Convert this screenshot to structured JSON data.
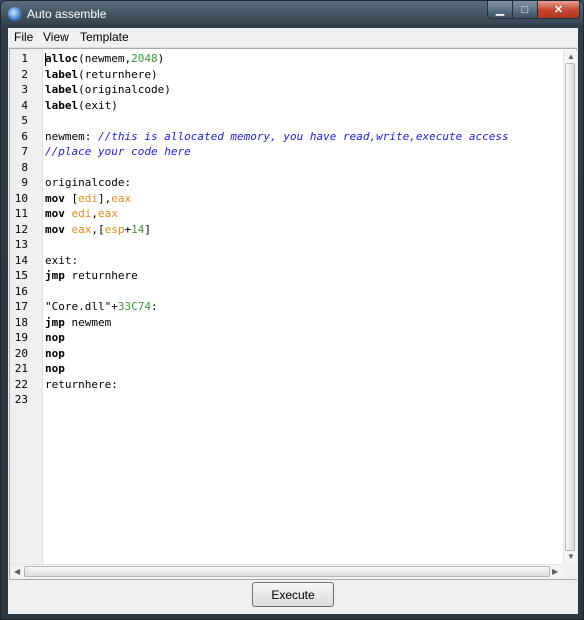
{
  "window": {
    "title": "Auto assemble",
    "controls": {
      "minimize": "▁",
      "maximize": "□",
      "close": "✕"
    }
  },
  "menu": {
    "items": [
      "File",
      "View",
      "Template"
    ]
  },
  "editor": {
    "line_numbers": [
      "1",
      "2",
      "3",
      "4",
      "5",
      "6",
      "7",
      "8",
      "9",
      "10",
      "11",
      "12",
      "13",
      "14",
      "15",
      "16",
      "17",
      "18",
      "19",
      "20",
      "21",
      "22",
      "23"
    ],
    "lines": [
      [
        {
          "t": "alloc",
          "c": "kw"
        },
        {
          "t": "(newmem,"
        },
        {
          "t": "2048",
          "c": "num"
        },
        {
          "t": ")"
        }
      ],
      [
        {
          "t": "label",
          "c": "kw"
        },
        {
          "t": "(returnhere)"
        }
      ],
      [
        {
          "t": "label",
          "c": "kw"
        },
        {
          "t": "(originalcode)"
        }
      ],
      [
        {
          "t": "label",
          "c": "kw"
        },
        {
          "t": "(exit)"
        }
      ],
      [],
      [
        {
          "t": "newmem: "
        },
        {
          "t": "//this is allocated memory, you have read,write,execute access",
          "c": "cmt"
        }
      ],
      [
        {
          "t": "//place your code here",
          "c": "cmt"
        }
      ],
      [],
      [
        {
          "t": "originalcode:"
        }
      ],
      [
        {
          "t": "mov",
          "c": "kw"
        },
        {
          "t": " ["
        },
        {
          "t": "edi",
          "c": "reg"
        },
        {
          "t": "],"
        },
        {
          "t": "eax",
          "c": "reg"
        }
      ],
      [
        {
          "t": "mov",
          "c": "kw"
        },
        {
          "t": " "
        },
        {
          "t": "edi",
          "c": "reg"
        },
        {
          "t": ","
        },
        {
          "t": "eax",
          "c": "reg"
        }
      ],
      [
        {
          "t": "mov",
          "c": "kw"
        },
        {
          "t": " "
        },
        {
          "t": "eax",
          "c": "reg"
        },
        {
          "t": ",["
        },
        {
          "t": "esp",
          "c": "reg"
        },
        {
          "t": "+"
        },
        {
          "t": "14",
          "c": "num"
        },
        {
          "t": "]"
        }
      ],
      [],
      [
        {
          "t": "exit:"
        }
      ],
      [
        {
          "t": "jmp",
          "c": "kw"
        },
        {
          "t": " returnhere"
        }
      ],
      [],
      [
        {
          "t": "\"Core.dll\"+"
        },
        {
          "t": "33C74",
          "c": "num"
        },
        {
          "t": ":"
        }
      ],
      [
        {
          "t": "jmp",
          "c": "kw"
        },
        {
          "t": " newmem"
        }
      ],
      [
        {
          "t": "nop",
          "c": "kw"
        }
      ],
      [
        {
          "t": "nop",
          "c": "kw"
        }
      ],
      [
        {
          "t": "nop",
          "c": "kw"
        }
      ],
      [
        {
          "t": "returnhere:"
        }
      ],
      []
    ]
  },
  "footer": {
    "execute_label": "Execute"
  }
}
